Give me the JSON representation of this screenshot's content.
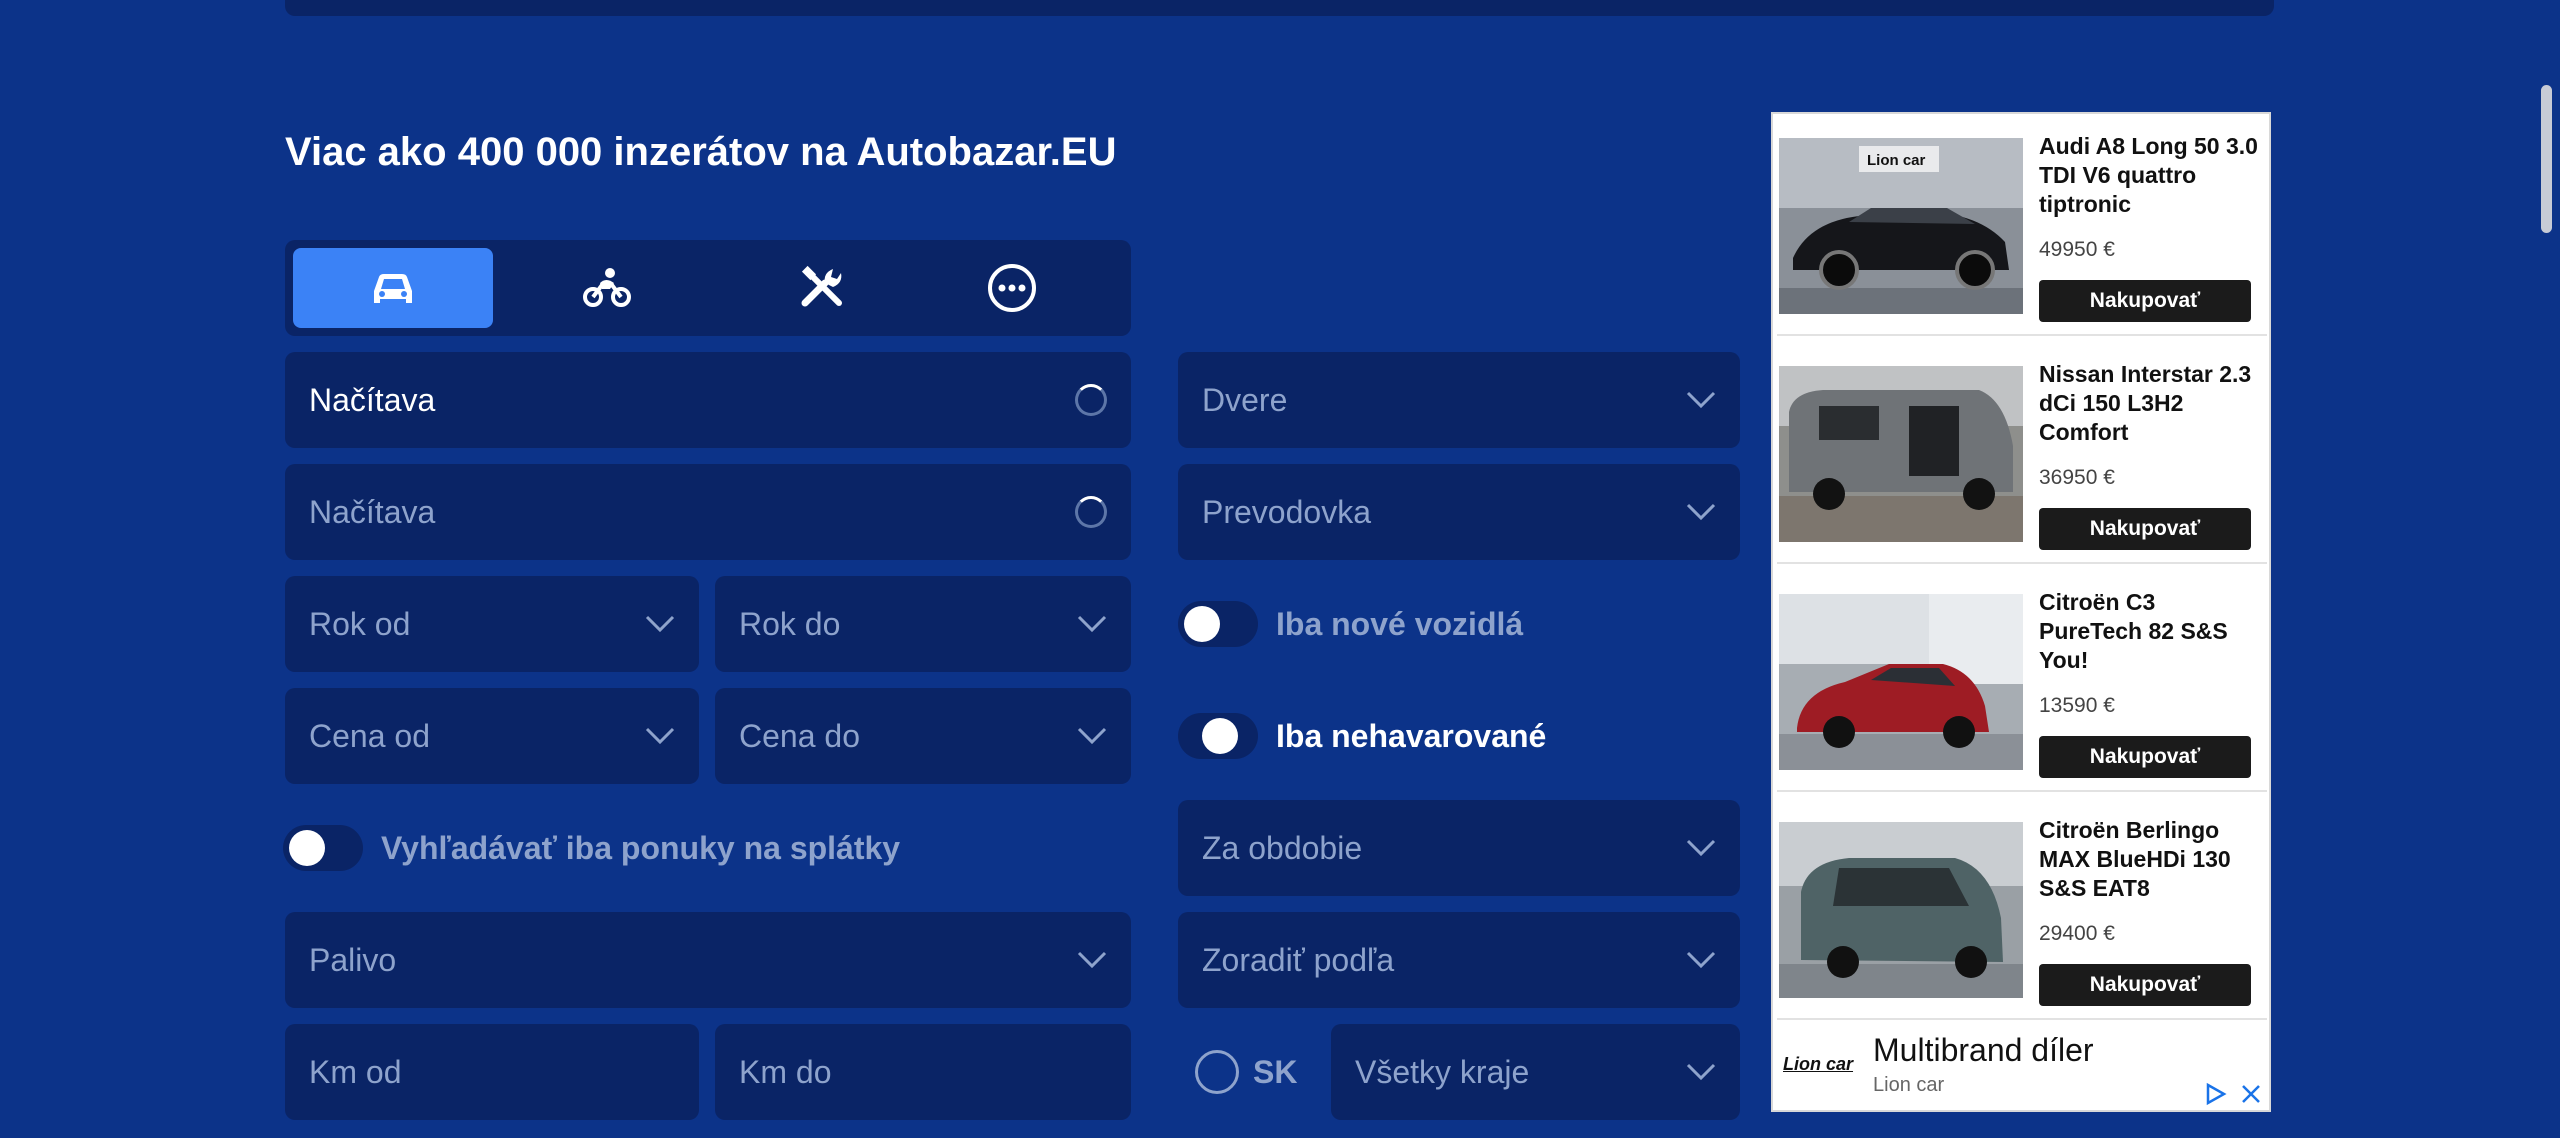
{
  "headline": "Viac ako 400 000 inzerátov na Autobazar.EU",
  "tabs": [
    {
      "icon": "car-icon",
      "active": true
    },
    {
      "icon": "motorcycle-icon",
      "active": false
    },
    {
      "icon": "tools-icon",
      "active": false
    },
    {
      "icon": "more-icon",
      "active": false
    }
  ],
  "form": {
    "brand": "Načítava",
    "model": "Načítava",
    "year_from": "Rok od",
    "year_to": "Rok do",
    "price_from": "Cena od",
    "price_to": "Cena do",
    "installments_toggle": "Vyhľadávať iba ponuky na splátky",
    "fuel": "Palivo",
    "km_from": "Km od",
    "km_to": "Km do",
    "doors": "Dvere",
    "transmission": "Prevodovka",
    "new_only_toggle": "Iba nové vozidlá",
    "undamaged_toggle": "Iba nehavarované",
    "period": "Za obdobie",
    "sort": "Zoradiť podľa",
    "country": "SK",
    "region": "Všetky kraje"
  },
  "ad": {
    "items": [
      {
        "title": "Audi A8 Long 50 3.0 TDI V6 quattro tiptronic",
        "price": "49950 €",
        "button": "Nakupovať",
        "image_logo": "Lion car"
      },
      {
        "title": "Nissan Interstar 2.3 dCi 150 L3H2 Comfort",
        "price": "36950 €",
        "button": "Nakupovať"
      },
      {
        "title": "Citroën C3 PureTech 82 S&S You!",
        "price": "13590 €",
        "button": "Nakupovať"
      },
      {
        "title": "Citroën Berlingo MAX BlueHDi 130 S&S EAT8",
        "price": "29400 €",
        "button": "Nakupovať"
      }
    ],
    "footer_logo": "Lion car",
    "footer_title": "Multibrand díler",
    "footer_sub": "Lion car"
  },
  "colors": {
    "background": "#0c3389",
    "field": "#0a2466",
    "active_tab": "#3b82f6",
    "dim_text": "#8ea3cc"
  }
}
